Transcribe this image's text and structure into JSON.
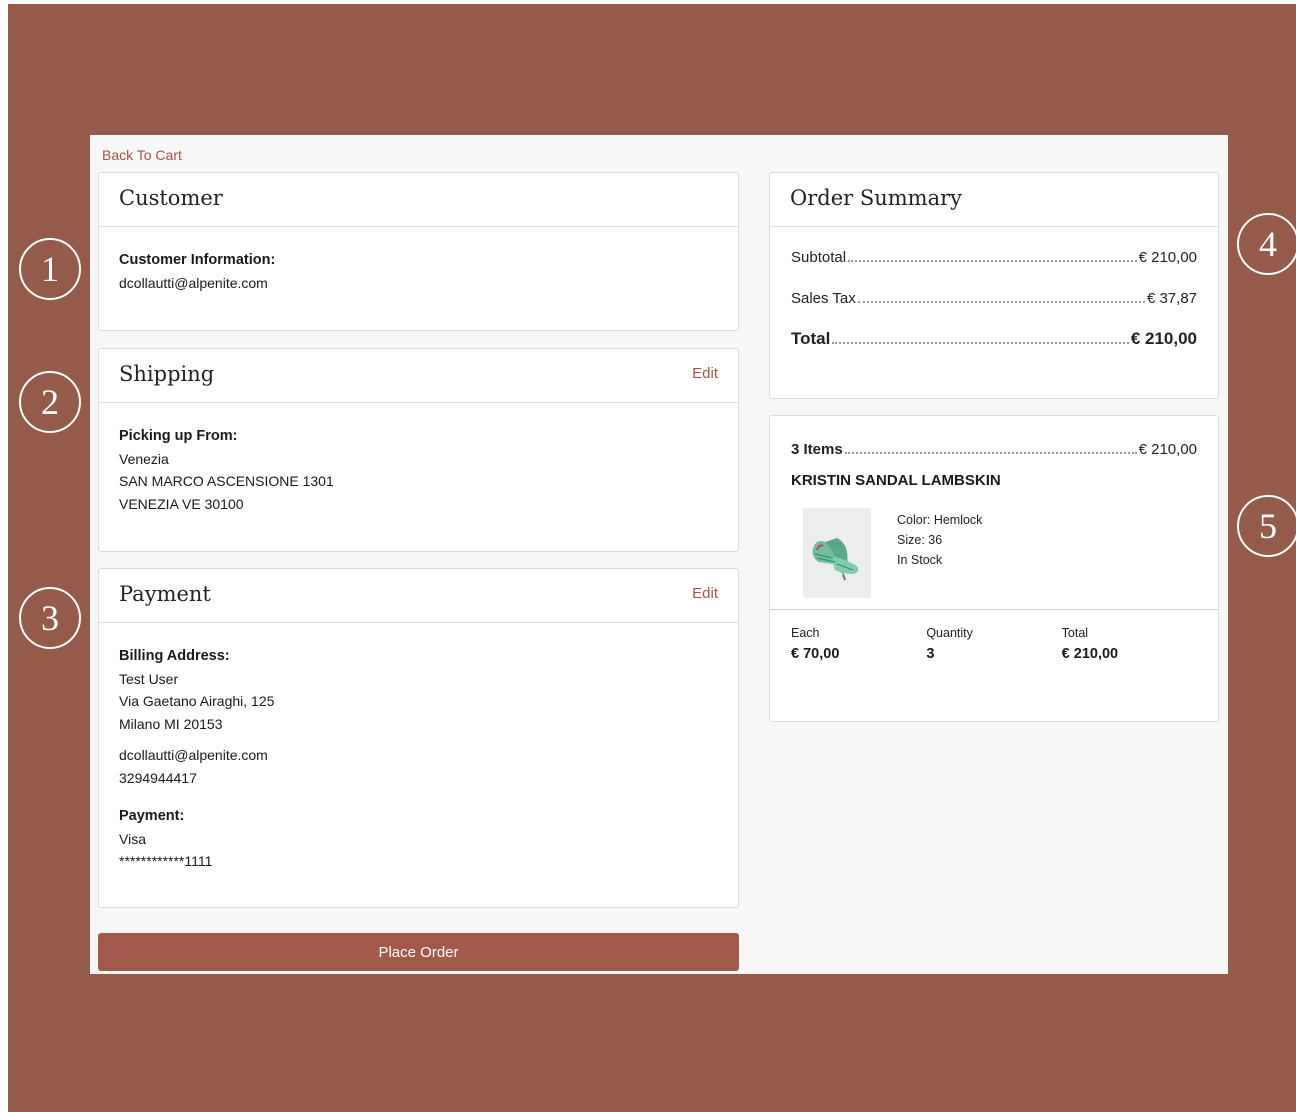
{
  "nav": {
    "back_label": "Back To Cart"
  },
  "customer": {
    "title": "Customer",
    "info_label": "Customer Information:",
    "email": "dcollautti@alpenite.com"
  },
  "shipping": {
    "title": "Shipping",
    "edit_label": "Edit",
    "pickup_label": "Picking up From:",
    "store_name": "Venezia",
    "address_line1": "SAN MARCO ASCENSIONE 1301",
    "address_line2": "VENEZIA VE 30100"
  },
  "payment": {
    "title": "Payment",
    "edit_label": "Edit",
    "billing_label": "Billing Address:",
    "name": "Test User",
    "street": "Via Gaetano Airaghi, 125",
    "city": "Milano MI 20153",
    "email": "dcollautti@alpenite.com",
    "phone": "3294944417",
    "payment_label": "Payment:",
    "card_type": "Visa",
    "card_number": "************1111"
  },
  "actions": {
    "place_order_label": "Place Order"
  },
  "summary": {
    "title": "Order Summary",
    "subtotal_label": "Subtotal",
    "subtotal_value": "€ 210,00",
    "tax_label": "Sales Tax",
    "tax_value": "€ 37,87",
    "total_label": "Total",
    "total_value": "€ 210,00"
  },
  "items": {
    "count_label": "3 Items",
    "count_value": "€ 210,00",
    "product": {
      "name": "KRISTIN SANDAL LAMBSKIN",
      "color": "Color: Hemlock",
      "size": "Size: 36",
      "stock": "In Stock",
      "each_label": "Each",
      "each_value": "€ 70,00",
      "qty_label": "Quantity",
      "qty_value": "3",
      "total_label": "Total",
      "total_value": "€ 210,00"
    }
  },
  "callouts": [
    "1",
    "2",
    "3",
    "4",
    "5"
  ],
  "colors": {
    "brand": "#a15a49",
    "frame": "#945a4a",
    "link": "#9b5848",
    "shoe": "#6fbf9f"
  }
}
